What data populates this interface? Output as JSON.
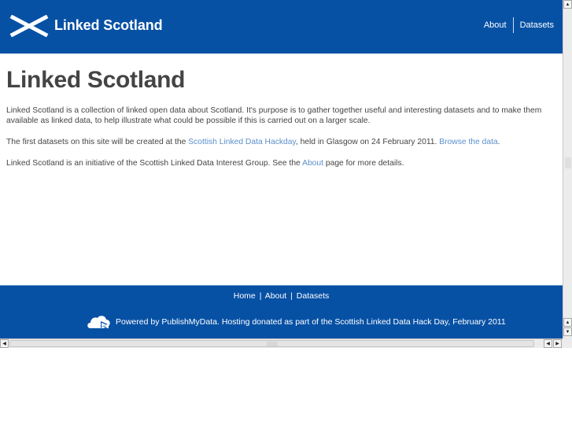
{
  "header": {
    "logo_icon": "saltire-flag-icon",
    "brand": "Linked Scotland",
    "nav": [
      {
        "label": "About"
      },
      {
        "label": "Datasets"
      }
    ],
    "background_color": "#0751a5"
  },
  "main": {
    "title": "Linked Scotland",
    "paragraphs": {
      "intro": "Linked Scotland is a collection of linked open data about Scotland. It's purpose is to gather together useful and interesting datasets and to make them available as linked data, to help illustrate what could be possible if this is carried out on a larger scale.",
      "hackday_before": "The first datasets on this site will be created at the ",
      "hackday_link": "Scottish Linked Data Hackday",
      "hackday_middle": ", held in Glasgow on 24 February 2011. ",
      "browse_link": "Browse the data",
      "hackday_after": ".",
      "initiative_before": "Linked Scotland is an initiative of the Scottish Linked Data Interest Group. See the ",
      "about_link": "About",
      "initiative_after": " page for more details."
    },
    "link_color": "#5b8fcb",
    "text_color": "#444444"
  },
  "footer": {
    "links": [
      {
        "label": "Home"
      },
      {
        "label": "About"
      },
      {
        "label": "Datasets"
      }
    ],
    "separator": "|",
    "powered_icon": "cloud-cursor-icon",
    "powered_text": "Powered by PublishMyData. Hosting donated as part of the Scottish Linked Data Hack Day, February 2011"
  },
  "scrollbars": {
    "up_arrow": "▲",
    "down_arrow": "▼",
    "left_arrow": "◀",
    "right_arrow": "▶"
  }
}
